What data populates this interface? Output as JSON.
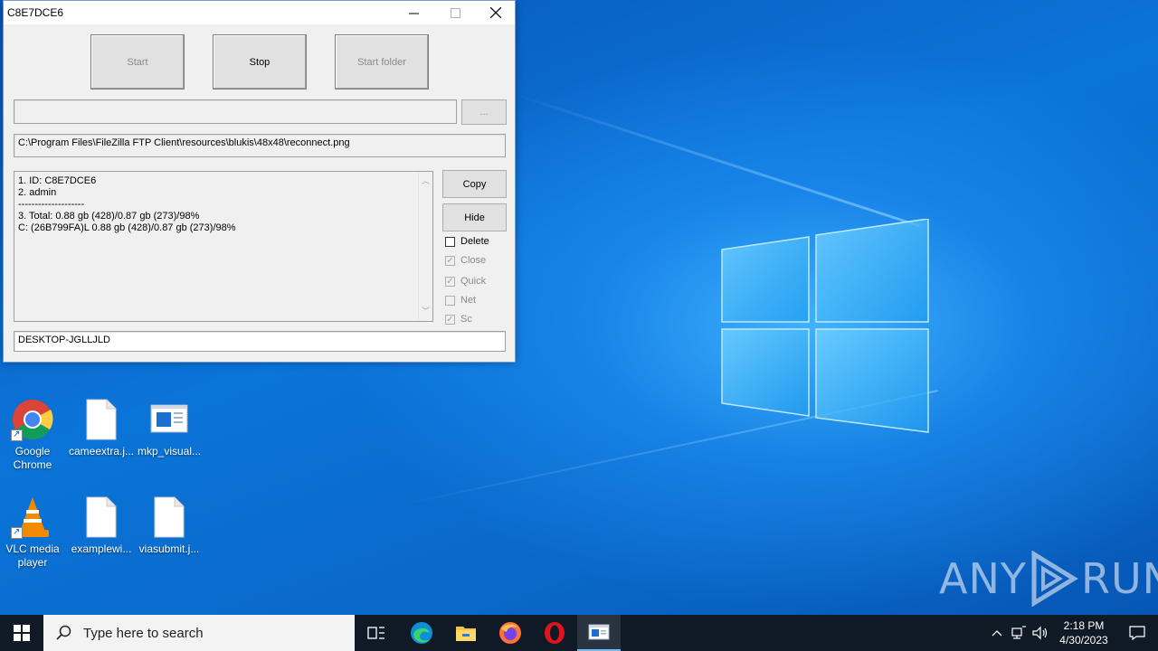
{
  "window": {
    "title": "C8E7DCE6",
    "buttons": {
      "start": "Start",
      "stop": "Stop",
      "start_folder": "Start folder",
      "browse": "...",
      "copy": "Copy",
      "hide": "Hide"
    },
    "path_input": "",
    "current_file": "C:\\Program Files\\FileZilla FTP Client\\resources\\blukis\\48x48\\reconnect.png",
    "log_lines": [
      "1. ID: C8E7DCE6",
      "2. admin",
      "--------------------",
      "3. Total: 0.88 gb (428)/0.87 gb (273)/98%",
      "C: (26B799FA)L 0.88 gb (428)/0.87 gb (273)/98%"
    ],
    "checkboxes": [
      {
        "label": "Delete",
        "checked": false,
        "enabled": true
      },
      {
        "label": "Close",
        "checked": true,
        "enabled": false
      },
      {
        "label": "Quick",
        "checked": true,
        "enabled": false
      },
      {
        "label": "Net",
        "checked": false,
        "enabled": false
      },
      {
        "label": "Sc",
        "checked": true,
        "enabled": false
      }
    ],
    "hostname": "DESKTOP-JGLLJLD"
  },
  "desktop_icons": [
    {
      "label": "Google Chrome",
      "icon": "chrome-icon"
    },
    {
      "label": "cameextra.j...",
      "icon": "file-icon"
    },
    {
      "label": "mkp_visual...",
      "icon": "app-file-icon"
    },
    {
      "label": "VLC media player",
      "icon": "vlc-icon"
    },
    {
      "label": "examplewi...",
      "icon": "file-icon"
    },
    {
      "label": "viasubmit.j...",
      "icon": "file-icon"
    }
  ],
  "watermark": {
    "left": "ANY",
    "right": "RUN"
  },
  "taskbar": {
    "search_placeholder": "Type here to search",
    "time": "2:18 PM",
    "date": "4/30/2023",
    "pinned": [
      "task-view-icon",
      "edge-icon",
      "file-explorer-icon",
      "firefox-icon",
      "opera-icon",
      "running-app-icon"
    ]
  },
  "colors": {
    "desktop": "#0b6fd0",
    "taskbar": "#101a26",
    "window_bg": "#f0f0f0"
  }
}
